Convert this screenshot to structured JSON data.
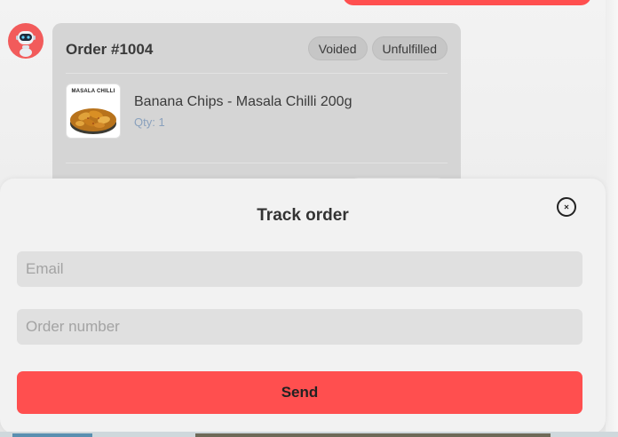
{
  "colors": {
    "accent": "#ff4f4f",
    "card_background": "#d5d5d5",
    "sheet_background": "#f2f2f2",
    "field_background": "#e0e0e0",
    "qty_text": "#8aa1bd"
  },
  "order": {
    "title": "Order #1004",
    "badges": [
      "Voided",
      "Unfulfilled"
    ],
    "item": {
      "thumbnail_title": "MASALA CHILLI",
      "thumbnail_subtitle": "",
      "thumbnail_icon": "banana-chips-product-image",
      "name": "Banana Chips - Masala Chilli 200g",
      "qty": "Qty: 1"
    }
  },
  "bot": {
    "avatar_icon": "robot-icon"
  },
  "track_sheet": {
    "title": "Track order",
    "close_icon": "close-icon",
    "email_placeholder": "Email",
    "email_value": "",
    "order_placeholder": "Order number",
    "order_value": "",
    "send_label": "Send"
  }
}
